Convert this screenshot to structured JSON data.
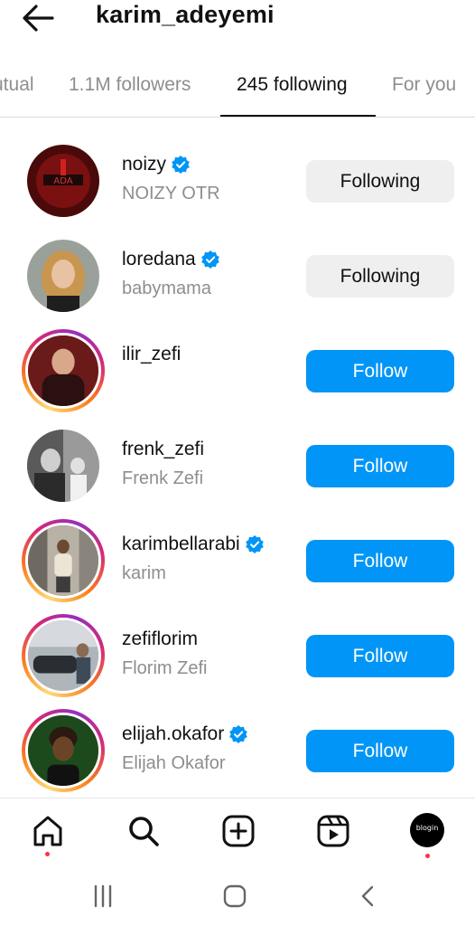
{
  "header": {
    "back_icon": "arrow-left-icon",
    "username": "karim_adeyemi"
  },
  "tabs": [
    {
      "label": "Mutual",
      "visible_text": "utual",
      "active": false
    },
    {
      "label": "1.1M followers",
      "active": false
    },
    {
      "label": "245 following",
      "active": true
    },
    {
      "label": "For you",
      "active": false
    }
  ],
  "users": [
    {
      "handle": "noizy",
      "verified": true,
      "subname": "NOIZY OTR",
      "button": "Following",
      "story": false
    },
    {
      "handle": "loredana",
      "verified": true,
      "subname": "babymama",
      "button": "Following",
      "story": false
    },
    {
      "handle": "ilir_zefi",
      "verified": false,
      "subname": "",
      "button": "Follow",
      "story": true
    },
    {
      "handle": "frenk_zefi",
      "verified": false,
      "subname": "Frenk Zefi",
      "button": "Follow",
      "story": false
    },
    {
      "handle": "karimbellarabi",
      "verified": true,
      "subname": "karim",
      "button": "Follow",
      "story": true
    },
    {
      "handle": "zefiflorim",
      "verified": false,
      "subname": "Florim Zefi",
      "button": "Follow",
      "story": true
    },
    {
      "handle": "elijah.okafor",
      "verified": true,
      "subname": "Elijah Okafor",
      "button": "Follow",
      "story": true
    }
  ],
  "bottom_nav": {
    "items": [
      "home-icon",
      "search-icon",
      "create-icon",
      "reels-icon",
      "profile-avatar"
    ],
    "profile_avatar_text": "blogin"
  },
  "system_nav": [
    "recents-icon",
    "home-circle-icon",
    "back-chevron-icon"
  ],
  "colors": {
    "follow_blue": "#0095f6",
    "following_gray": "#efefef",
    "verified_blue": "#0095f6",
    "notification_red": "#ff3040"
  }
}
